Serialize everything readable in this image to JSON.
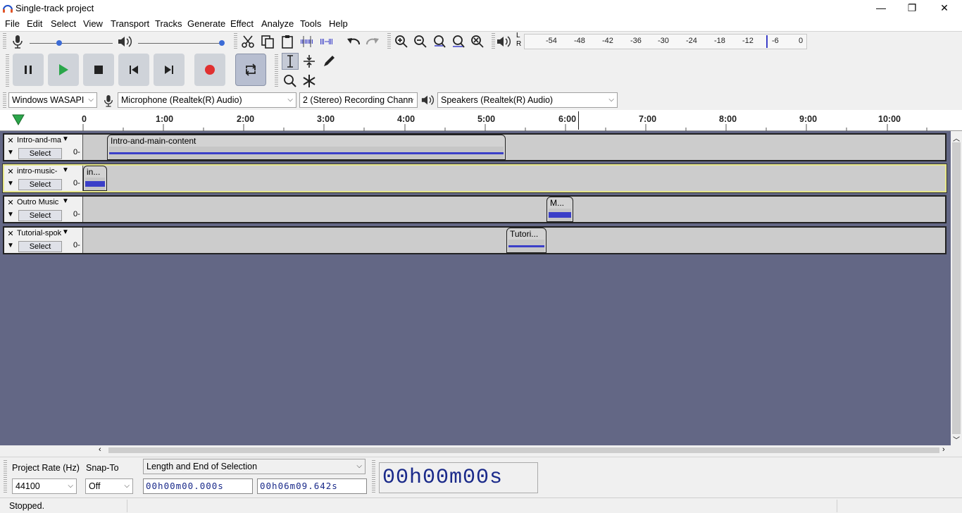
{
  "window": {
    "title": "Single-track project",
    "minimize": "—",
    "restore": "❐",
    "close": "✕"
  },
  "menu": [
    "File",
    "Edit",
    "Select",
    "View",
    "Transport",
    "Tracks",
    "Generate",
    "Effect",
    "Analyze",
    "Tools",
    "Help"
  ],
  "meter": {
    "left_label": "L",
    "right_label": "R",
    "ticks": [
      "-54",
      "-48",
      "-42",
      "-36",
      "-30",
      "-24",
      "-18",
      "-12",
      "-6",
      "0"
    ]
  },
  "devices": {
    "host": "Windows WASAPI",
    "recording_device": "Microphone (Realtek(R) Audio)",
    "channels": "2 (Stereo) Recording Chann",
    "playback_device": "Speakers (Realtek(R) Audio)"
  },
  "ruler": {
    "labels": [
      "0",
      "1:00",
      "2:00",
      "3:00",
      "4:00",
      "5:00",
      "6:00",
      "7:00",
      "8:00",
      "9:00",
      "10:00"
    ]
  },
  "tracks": [
    {
      "name": "Intro-and-ma",
      "select": "Select",
      "gain": "0-",
      "clip": "Intro-and-main-content"
    },
    {
      "name": "intro-music-",
      "select": "Select",
      "gain": "0-",
      "clip": "in..."
    },
    {
      "name": "Outro Music",
      "select": "Select",
      "gain": "0-",
      "clip": "M..."
    },
    {
      "name": "Tutorial-spok",
      "select": "Select",
      "gain": "0-",
      "clip": "Tutori..."
    }
  ],
  "selection": {
    "project_rate_label": "Project Rate (Hz)",
    "project_rate": "44100",
    "snap_label": "Snap-To",
    "snap_value": "Off",
    "mode": "Length and End of Selection",
    "start": "00h00m00.000s",
    "end": "00h06m09.642s",
    "audio_position": "00h00m00s"
  },
  "status": "Stopped.",
  "colors": {
    "accent": "#3b3fc8",
    "track_bg": "#636785",
    "record": "#e03030",
    "play": "#2aa64a"
  }
}
